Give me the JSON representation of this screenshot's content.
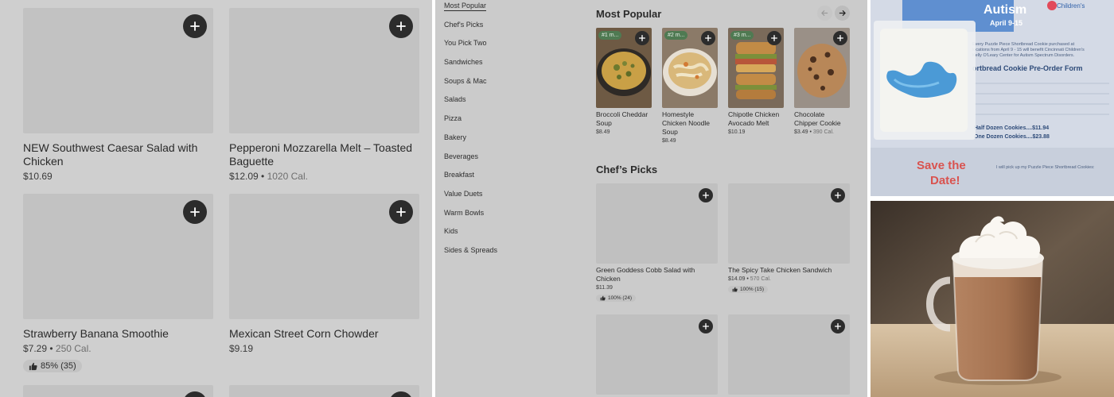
{
  "left_items": [
    {
      "name": "NEW Southwest Caesar Salad with Chicken",
      "price": "$10.69",
      "calories": ""
    },
    {
      "name": "Pepperoni Mozzarella Melt – Toasted Baguette",
      "price": "$12.09",
      "calories": "1020 Cal."
    },
    {
      "name": "Strawberry Banana Smoothie",
      "price": "$7.29",
      "calories": "250 Cal.",
      "rating": "85% (35)"
    },
    {
      "name": "Mexican Street Corn Chowder",
      "price": "$9.19",
      "calories": ""
    }
  ],
  "menu": {
    "categories": [
      "Most Popular",
      "Chef's Picks",
      "You Pick Two",
      "Sandwiches",
      "Soups & Mac",
      "Salads",
      "Pizza",
      "Bakery",
      "Beverages",
      "Breakfast",
      "Value Duets",
      "Warm Bowls",
      "Kids",
      "Sides & Spreads"
    ],
    "active_category": "Most Popular",
    "most_popular_title": "Most Popular",
    "chefs_picks_title": "Chef’s Picks",
    "popular": [
      {
        "rank": "#1 m...",
        "name": "Broccoli Cheddar Soup",
        "price": "$8.49",
        "calories": ""
      },
      {
        "rank": "#2 m...",
        "name": "Homestyle Chicken Noodle Soup",
        "price": "$8.49",
        "calories": ""
      },
      {
        "rank": "#3 m...",
        "name": "Chipotle Chicken Avocado Melt",
        "price": "$10.19",
        "calories": ""
      },
      {
        "rank": "",
        "name": "Chocolate Chipper Cookie",
        "price": "$3.49",
        "calories": "390 Cal."
      }
    ],
    "chefs_picks": [
      {
        "name": "Green Goddess Cobb Salad with Chicken",
        "price": "$11.39",
        "calories": "",
        "rating": "100% (24)"
      },
      {
        "name": "The Spicy Take Chicken Sandwich",
        "price": "$14.09",
        "calories": "570 Cal.",
        "rating": "100% (15)"
      }
    ]
  },
  "flyer": {
    "headline": "Autism",
    "dates": "April 9-15",
    "org": "Children's",
    "body_line1": "Every Puzzle Piece Shortbread Cookie purchased at",
    "body_line2": "locations from April 9 - 15 will benefit Cincinnati Children's",
    "body_line3": "Kelly O'Leary Center for Autism Spectrum Disorders.",
    "form_title": "ortbread Cookie Pre-Order Form",
    "half_dozen": "Half Dozen Cookies....$11.94",
    "one_dozen": "One Dozen Cookies....$23.88",
    "save_the_date_1": "Save the",
    "save_the_date_2": "Date!",
    "pickup": "I will pick up my Puzzle Piece Shortbread Cookies:"
  },
  "icons": {
    "add": "plus-icon",
    "rating": "thumbs-up-icon",
    "prev": "arrow-left-icon",
    "next": "arrow-right-icon"
  },
  "colors": {
    "add_button": "#2c2c2c",
    "rank_badge": "#4f7a52",
    "save_the_date": "#d9534f"
  }
}
